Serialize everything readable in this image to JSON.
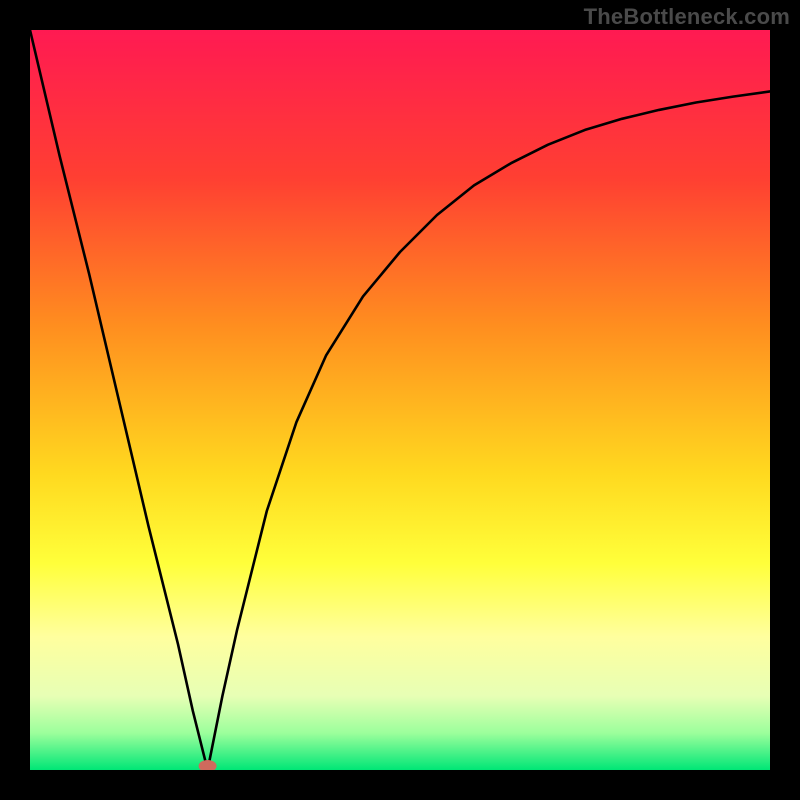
{
  "watermark": "TheBottleneck.com",
  "chart_data": {
    "type": "line",
    "title": "",
    "xlabel": "",
    "ylabel": "",
    "xlim": [
      0,
      100
    ],
    "ylim": [
      0,
      100
    ],
    "marker": {
      "x": 24,
      "y": 0,
      "color": "#cf6a5d"
    },
    "background_gradient": {
      "stops": [
        {
          "offset": 0.0,
          "color": "#ff1a52"
        },
        {
          "offset": 0.2,
          "color": "#ff3f32"
        },
        {
          "offset": 0.4,
          "color": "#ff8e1f"
        },
        {
          "offset": 0.6,
          "color": "#ffd91f"
        },
        {
          "offset": 0.72,
          "color": "#ffff3a"
        },
        {
          "offset": 0.82,
          "color": "#ffff9e"
        },
        {
          "offset": 0.9,
          "color": "#e7ffb5"
        },
        {
          "offset": 0.95,
          "color": "#9cff9c"
        },
        {
          "offset": 1.0,
          "color": "#00e676"
        }
      ]
    },
    "series": [
      {
        "name": "curve",
        "color": "#000000",
        "x": [
          0,
          4,
          8,
          12,
          16,
          20,
          22,
          24,
          26,
          28,
          32,
          36,
          40,
          45,
          50,
          55,
          60,
          65,
          70,
          75,
          80,
          85,
          90,
          95,
          100
        ],
        "y": [
          100,
          83,
          67,
          50,
          33,
          17,
          8,
          0,
          10,
          19,
          35,
          47,
          56,
          64,
          70,
          75,
          79,
          82,
          84.5,
          86.5,
          88,
          89.2,
          90.2,
          91,
          91.7
        ]
      }
    ]
  }
}
